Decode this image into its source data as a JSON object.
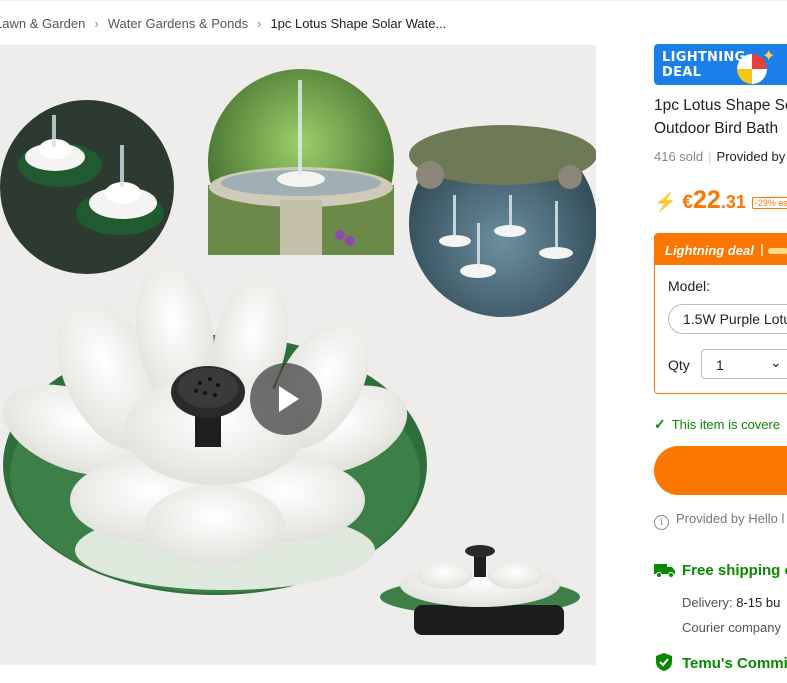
{
  "breadcrumb": {
    "items": [
      "Lawn & Garden",
      "Water Gardens & Ponds",
      "1pc Lotus Shape Solar Wate..."
    ]
  },
  "gallery": {
    "play_icon": "play-icon"
  },
  "product": {
    "badge_line1": "LIGHTNING",
    "badge_line2": "DEAL",
    "title_line1": "1pc Lotus Shape So",
    "title_line2": "Outdoor Bird Bath",
    "sold": "416 sold",
    "provided_by": "Provided by"
  },
  "price": {
    "currency": "€",
    "integer": "22",
    "decimal": ".31",
    "discount": "-29% est",
    "color": "#fb7701"
  },
  "deal_box": {
    "title": "Lightning deal",
    "model_label": "Model:",
    "model_value": "1.5W Purple Lotu",
    "qty_label": "Qty",
    "qty_value": "1"
  },
  "protection": {
    "covered_text": "This item is covere"
  },
  "seller": {
    "provided_text": "Provided by Hello l"
  },
  "shipping": {
    "title": "Free shipping o",
    "delivery_label": "Delivery:",
    "delivery_value": "8-15 bu",
    "courier_text": "Courier company"
  },
  "commitment": {
    "title": "Temu's Commi"
  },
  "colors": {
    "accent": "#fb7701",
    "green": "#0a8800",
    "badge_blue": "#1a7fe8"
  }
}
